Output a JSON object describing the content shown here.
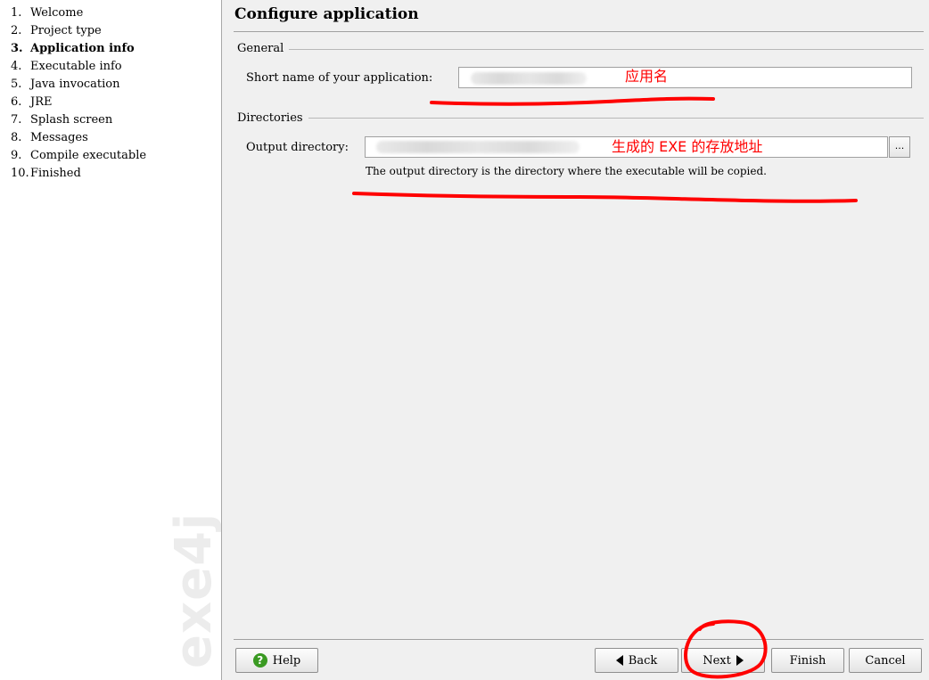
{
  "sidebar": {
    "steps": [
      {
        "num": "1.",
        "label": "Welcome"
      },
      {
        "num": "2.",
        "label": "Project type"
      },
      {
        "num": "3.",
        "label": "Application info"
      },
      {
        "num": "4.",
        "label": "Executable info"
      },
      {
        "num": "5.",
        "label": "Java invocation"
      },
      {
        "num": "6.",
        "label": "JRE"
      },
      {
        "num": "7.",
        "label": "Splash screen"
      },
      {
        "num": "8.",
        "label": "Messages"
      },
      {
        "num": "9.",
        "label": "Compile executable"
      },
      {
        "num": "10.",
        "label": "Finished"
      }
    ],
    "active_step": 3,
    "watermark": "exe4j"
  },
  "main": {
    "title": "Configure application",
    "general": {
      "section_label": "General",
      "short_name_label": "Short name of your application:",
      "short_name_value": ""
    },
    "directories": {
      "section_label": "Directories",
      "output_dir_label": "Output directory:",
      "output_dir_value": "",
      "browse_label": "...",
      "hint": "The output directory is the directory where the executable will be copied."
    }
  },
  "annotations": {
    "app_name_note": "应用名",
    "output_dir_note": "生成的 EXE 的存放地址",
    "color": "#ff0000"
  },
  "buttons": {
    "help": "Help",
    "back": "Back",
    "next": "Next",
    "finish": "Finish",
    "cancel": "Cancel"
  },
  "icons": {
    "help": "help-icon",
    "back": "triangle-left-icon",
    "next": "triangle-right-icon"
  }
}
